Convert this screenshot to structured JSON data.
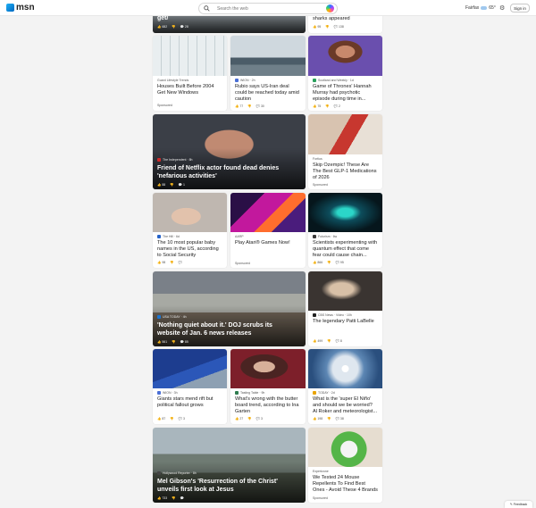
{
  "header": {
    "logo_text": "msn",
    "search_placeholder": "Search the web",
    "weather_location": "Fairfax",
    "weather_temp": "65°",
    "signin_label": "Sign in"
  },
  "cards": {
    "c0": {
      "title": "get/",
      "likes": "682",
      "comments": "28"
    },
    "c1": {
      "title": "sharks appeared",
      "likes": "95",
      "comments": "138"
    },
    "c2": {
      "source": "Guard Lifestyle Trends",
      "title": "Houses Built Before 2004 Get New Windows",
      "sponsored": "Sponsored"
    },
    "c3": {
      "source": "WION · 2h",
      "title": "Rubio says US-Iran deal could be reached today amid caution",
      "likes": "77",
      "comments": "30"
    },
    "c4": {
      "source": "Scotland and Weekly · 1d",
      "title": "Game of Thrones' Hannah Murray had psychotic episode during time in...",
      "likes": "75",
      "comments": "2"
    },
    "c5": {
      "source": "The Independent · 8h",
      "title": "Friend of Netflix actor found dead denies 'nefarious activities'",
      "likes": "88",
      "comments": "1"
    },
    "c6": {
      "source": "Fortius",
      "title": "Skip Ozempic! These Are The Best GLP-1 Medications of 2026",
      "sponsored": "Sponsored"
    },
    "c7": {
      "source": "The Hill · 6d",
      "title": "The 10 most popular baby names in the US, according to Social Security",
      "likes": "98",
      "comments": ""
    },
    "c8": {
      "source": "AARP",
      "title": "Play Atari® Games Now!",
      "sponsored": "Sponsored"
    },
    "c9": {
      "source": "Futurism · 6w",
      "title": "Scientists experimenting with quantum effect that come fear could cause chain...",
      "likes": "866",
      "comments": "95"
    },
    "c10": {
      "source": "USA TODAY · 4h",
      "title": "'Nothing quiet about it.' DOJ scrubs its website of Jan. 6 news releases",
      "likes": "561",
      "comments": "85"
    },
    "c11": {
      "source": "CBS News · Video · 10h",
      "title": "The legendary Patti LaBelle",
      "likes": "499",
      "comments": "8"
    },
    "c12": {
      "source": "WION · 3h",
      "title": "Giants stars mend rift but political fallout grows",
      "likes": "87",
      "comments": "3"
    },
    "c13": {
      "source": "Tasting Table · 9h",
      "title": "What's wrong with the butter board trend, according to Ina Garten",
      "likes": "27",
      "comments": "3"
    },
    "c14": {
      "source": "TODAY · 2d",
      "title": "What is the 'super El Niño' and should we be worried? Al Roker and meteorologist...",
      "likes": "198",
      "comments": "38"
    },
    "c15": {
      "source": "Hollywood Reporter · 8h",
      "title": "Mel Gibson's 'Resurrection of the Christ' unveils first look at Jesus",
      "likes": "733",
      "comments": ""
    },
    "c16": {
      "source": "Expertzone",
      "title": "We Tested 24 Mouse Repellents To Find Best Ones - Avoid These 4 Brands",
      "sponsored": "Sponsored"
    }
  },
  "footer": {
    "feedback_label": "Feedback"
  },
  "colors": {
    "accent": "#0067c0",
    "background": "#f3f3f3"
  }
}
